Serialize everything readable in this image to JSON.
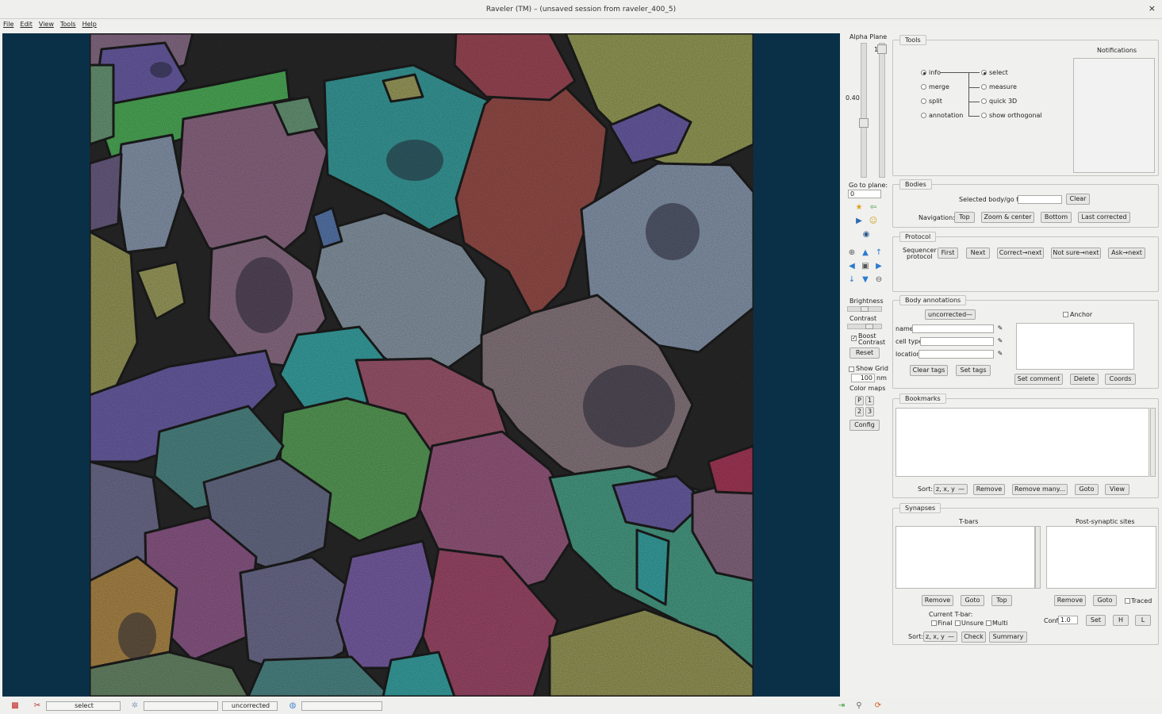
{
  "window": {
    "title": "Raveler (TM) – (unsaved session from raveler_400_5)",
    "close_glyph": "×"
  },
  "menu": [
    "File",
    "Edit",
    "View",
    "Tools",
    "Help"
  ],
  "alpha": {
    "label": "Alpha Plane",
    "top_value": "1",
    "value": "0.40",
    "level": 0.4
  },
  "goto": {
    "label": "Go to plane:",
    "value": "0"
  },
  "brightness": {
    "label": "Brightness"
  },
  "contrast": {
    "label": "Contrast"
  },
  "boost": {
    "label_line1": "Boost",
    "label_line2": "Contrast",
    "checked": true
  },
  "reset_label": "Reset",
  "grid": {
    "label": "Show Grid",
    "value": "100",
    "unit": "nm"
  },
  "colormaps": {
    "label": "Color maps",
    "buttons": [
      "P",
      "1",
      "2",
      "3"
    ]
  },
  "config_label": "Config",
  "tools": {
    "title": "Tools",
    "left": [
      "info",
      "merge",
      "split",
      "annotation"
    ],
    "right": [
      "select",
      "measure",
      "quick 3D",
      "show orthogonal"
    ],
    "notifications": "Notifications"
  },
  "bodies": {
    "title": "Bodies",
    "selected_label": "Selected body/go to:",
    "clear": "Clear",
    "nav_label": "Navigation:",
    "nav": [
      "Top",
      "Zoom & center",
      "Bottom",
      "Last corrected"
    ]
  },
  "protocol": {
    "title": "Protocol",
    "seq_line1": "Sequencer",
    "seq_line2": "protocol",
    "buttons": [
      "First",
      "Next",
      "Correct→next",
      "Not sure→next",
      "Ask→next"
    ]
  },
  "annotations": {
    "title": "Body annotations",
    "status": "uncorrected",
    "anchor": "Anchor",
    "fields": [
      "name",
      "cell type",
      "location"
    ],
    "clear_tags": "Clear tags",
    "set_tags": "Set tags",
    "set_comment": "Set comment",
    "delete": "Delete",
    "coords": "Coords"
  },
  "bookmarks": {
    "title": "Bookmarks",
    "sort_label": "Sort:",
    "sort_value": "z, x, y",
    "buttons": [
      "Remove",
      "Remove many...",
      "Goto",
      "View"
    ]
  },
  "synapses": {
    "title": "Synapses",
    "tbars": "T-bars",
    "psd": "Post-synaptic sites",
    "tbar_buttons": [
      "Remove",
      "Goto",
      "Top"
    ],
    "psd_buttons": [
      "Remove",
      "Goto"
    ],
    "traced": "Traced",
    "current_tbar": "Current T-bar:",
    "checks": [
      "Final",
      "Unsure",
      "Multi"
    ],
    "conf_label": "Conf",
    "conf_value": "1.0",
    "set": "Set",
    "h": "H",
    "l": "L",
    "sort_label": "Sort:",
    "sort_value": "z, x, y",
    "check": "Check",
    "summary": "Summary"
  },
  "status": {
    "tool": "select",
    "body_status": "uncorrected"
  }
}
